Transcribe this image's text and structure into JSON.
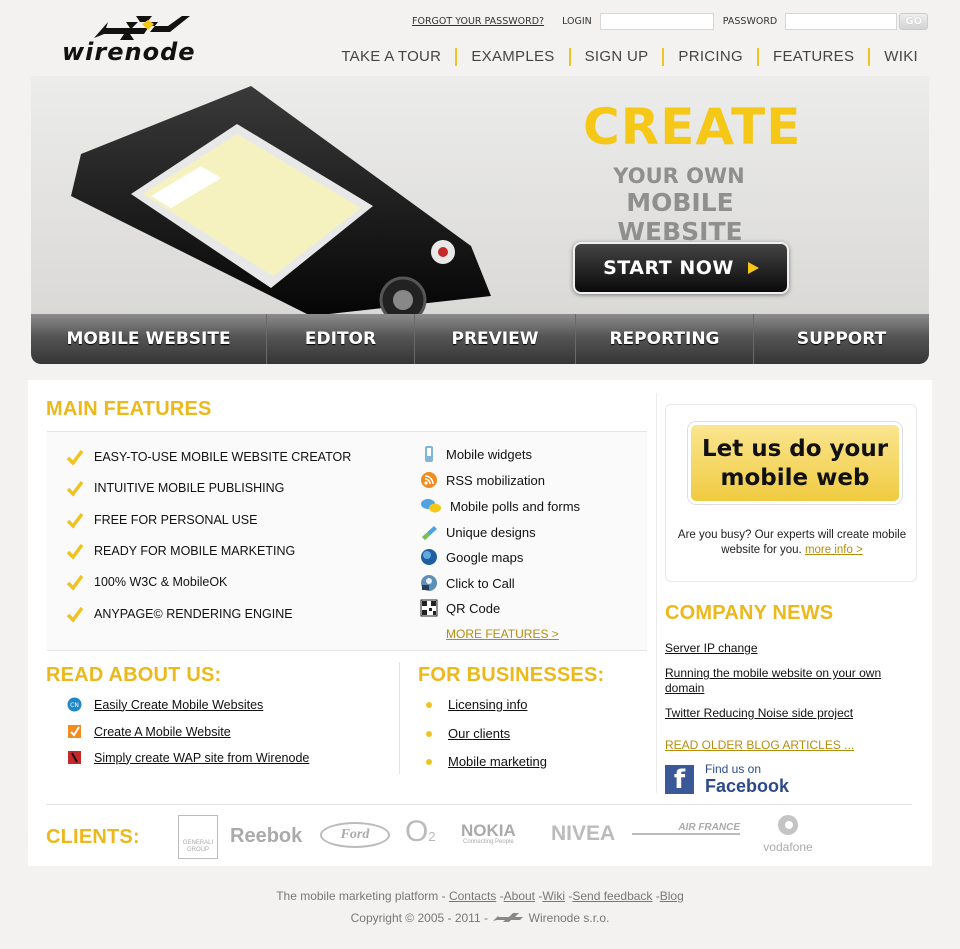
{
  "brand": {
    "name": "wirenode"
  },
  "login": {
    "forgot": "FORGOT YOUR PASSWORD?",
    "login_label": "LOGIN",
    "password_label": "PASSWORD",
    "go": "GO"
  },
  "topnav": [
    "TAKE A TOUR",
    "EXAMPLES",
    "SIGN UP",
    "PRICING",
    "FEATURES",
    "WIKI"
  ],
  "hero": {
    "headline": "CREATE",
    "line2": "YOUR OWN",
    "line3": "MOBILE WEBSITE",
    "cta": "START NOW",
    "nav": [
      "MOBILE WEBSITE",
      "EDITOR",
      "PREVIEW",
      "REPORTING",
      "SUPPORT"
    ]
  },
  "main_features": {
    "title": "MAIN FEATURES",
    "left": [
      "EASY-TO-USE MOBILE WEBSITE CREATOR",
      "INTUITIVE MOBILE PUBLISHING",
      "FREE FOR PERSONAL USE",
      "READY FOR MOBILE MARKETING",
      "100% W3C & MobileOK",
      "ANYPAGE© RENDERING ENGINE"
    ],
    "right": [
      {
        "label": "Mobile widgets",
        "icon": "phone-widget-icon"
      },
      {
        "label": "RSS mobilization",
        "icon": "rss-icon"
      },
      {
        "label": "Mobile polls and forms",
        "icon": "chat-bubbles-icon"
      },
      {
        "label": "Unique designs",
        "icon": "design-icon"
      },
      {
        "label": "Google maps",
        "icon": "globe-icon"
      },
      {
        "label": "Click to Call",
        "icon": "call-icon"
      },
      {
        "label": "QR Code",
        "icon": "qr-code-icon"
      }
    ],
    "more": "MORE FEATURES >"
  },
  "read_about": {
    "title": "READ ABOUT US:",
    "links": [
      "Easily Create Mobile Websites",
      "Create A Mobile Website",
      "Simply create WAP site from Wirenode"
    ]
  },
  "business": {
    "title": "FOR BUSINESSES:",
    "links": [
      "Licensing info",
      "Our clients",
      "Mobile marketing"
    ]
  },
  "promo": {
    "line1": "Let us do your",
    "line2": "mobile web",
    "text": "Are you busy? Our experts will create mobile website for you.",
    "more": "more info >"
  },
  "news": {
    "title": "COMPANY NEWS",
    "items": [
      "Server IP change",
      "Running the mobile website on your own domain",
      "Twitter Reducing Noise side project"
    ],
    "older": "READ OLDER BLOG ARTICLES ...",
    "fb_line1": "Find us on",
    "fb_line2": "Facebook"
  },
  "clients": {
    "title": "CLIENTS:",
    "logos": [
      "GENERALI",
      "GROUP",
      "Reebok",
      "Ford",
      "O",
      "2",
      "NOKIA",
      "Connecting People",
      "NIVEA",
      "AIR FRANCE",
      "vodafone"
    ]
  },
  "footer": {
    "tagline": "The mobile marketing platform -",
    "links": [
      "Contacts",
      "About",
      "Wiki",
      "Send feedback",
      "Blog"
    ],
    "copyright": "Copyright © 2005 - 2011 -",
    "company": "Wirenode s.r.o."
  }
}
